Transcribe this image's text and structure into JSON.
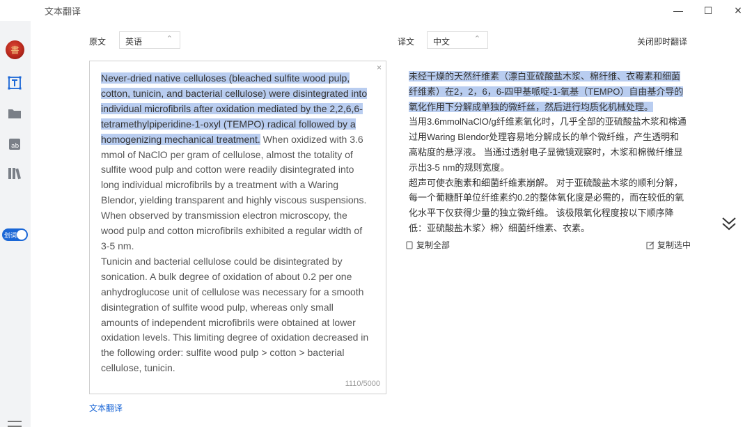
{
  "app": {
    "title": "文本翻译"
  },
  "window": {
    "minimize": "—",
    "maximize": "☐",
    "close": "✕"
  },
  "sidebar": {
    "avatar_glyph": "書",
    "toggle_label": "划词"
  },
  "source": {
    "label": "原文",
    "language": "英语",
    "highlighted": "Never-dried native celluloses (bleached sulfite wood pulp, cotton, tunicin, and bacterial cellulose) were disintegrated into individual microfibrils after oxidation mediated by the 2,2,6,6-tetramethylpiperidine-1-oxyl (TEMPO) radical followed by a homogenizing mechanical treatment.",
    "rest": " When oxidized with 3.6 mmol of NaClO per gram of cellulose, almost the totality of sulfite wood pulp and cotton were readily disintegrated into long individual microfibrils by a treatment with a Waring Blendor, yielding transparent and highly viscous suspensions. When observed by transmission electron microscopy, the wood pulp and cotton microfibrils exhibited a regular width of 3-5 nm.",
    "para2": "Tunicin and bacterial cellulose could be disintegrated by sonication. A bulk degree of oxidation of about 0.2 per one anhydroglucose unit of cellulose was necessary for a smooth disintegration of sulfite wood pulp, whereas only small amounts of independent microfibrils were obtained at lower oxidation levels. This limiting degree of oxidation decreased in the following order: sulfite wood pulp > cotton > bacterial cellulose, tunicin.",
    "counter": "1110/5000",
    "clear": "×"
  },
  "target": {
    "label": "译文",
    "language": "中文",
    "instant_toggle": "关闭即时翻译",
    "highlighted": "未经干燥的天然纤维素（漂白亚硫酸盐木浆、棉纤维、衣霉素和细菌纤维素）在2，2，6，6-四甲基哌啶-1-氧基（TEMPO）自由基介导的氧化作用下分解成单独的微纤丝，然后进行均质化机械处理。",
    "rest": "当用3.6mmolNaClO/g纤维素氧化时，几乎全部的亚硫酸盐木浆和棉通过用Waring Blendor处理容易地分解成长的单个微纤维，产生透明和高粘度的悬浮液。 当通过透射电子显微镜观察时，木浆和棉微纤维显示出3-5 nm的规则宽度。",
    "para2": "超声可使衣胞素和细菌纤维素崩解。 对于亚硫酸盐木浆的顺利分解，每一个葡糖酐单位纤维素约0.2的整体氧化度是必需的，而在较低的氧化水平下仅获得少量的独立微纤维。 该极限氧化程度按以下顺序降低：亚硫酸盐木浆〉棉〉细菌纤维素、衣素。",
    "copy_all": "复制全部",
    "copy_selected": "复制选中"
  },
  "footer": {
    "link": "文本翻译"
  }
}
